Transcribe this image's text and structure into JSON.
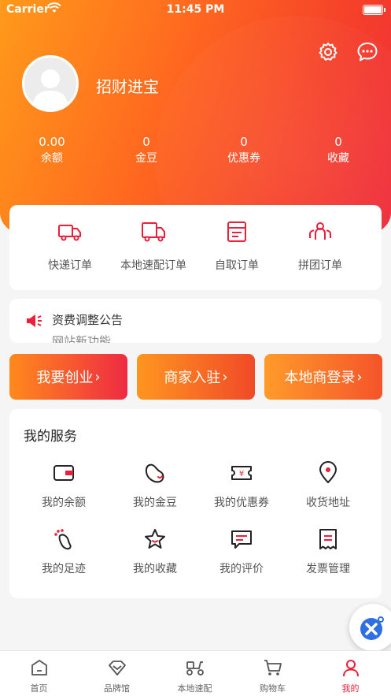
{
  "status_bar": {
    "carrier": "Carrier",
    "time": "11:45 PM"
  },
  "profile": {
    "name": "招财进宝"
  },
  "stats": [
    {
      "value": "0.00",
      "label": "余额"
    },
    {
      "value": "0",
      "label": "金豆"
    },
    {
      "value": "0",
      "label": "优惠券"
    },
    {
      "value": "0",
      "label": "收藏"
    }
  ],
  "orders": [
    {
      "label": "快递订单",
      "icon": "truck-icon"
    },
    {
      "label": "本地速配订单",
      "icon": "delivery-van-icon"
    },
    {
      "label": "自取订单",
      "icon": "receipt-icon"
    },
    {
      "label": "拼团订单",
      "icon": "group-icon"
    }
  ],
  "notice": {
    "text": "资费调整公告",
    "next_text": "网站新功能"
  },
  "actions": {
    "start_business": "我要创业",
    "merchant_join": "商家入驻",
    "local_login": "本地商登录"
  },
  "services": {
    "title": "我的服务",
    "items": [
      {
        "label": "我的余额",
        "icon": "wallet-icon"
      },
      {
        "label": "我的金豆",
        "icon": "bean-icon"
      },
      {
        "label": "我的优惠券",
        "icon": "coupon-icon"
      },
      {
        "label": "收货地址",
        "icon": "location-icon"
      },
      {
        "label": "我的足迹",
        "icon": "footprint-icon"
      },
      {
        "label": "我的收藏",
        "icon": "star-icon"
      },
      {
        "label": "我的评价",
        "icon": "comment-icon"
      },
      {
        "label": "发票管理",
        "icon": "invoice-icon"
      }
    ]
  },
  "tabs": [
    {
      "label": "首页",
      "icon": "home-icon"
    },
    {
      "label": "品牌馆",
      "icon": "diamond-icon"
    },
    {
      "label": "本地速配",
      "icon": "scooter-icon"
    },
    {
      "label": "购物车",
      "icon": "cart-icon"
    },
    {
      "label": "我的",
      "icon": "user-icon"
    }
  ],
  "colors": {
    "accent": "#e8203a",
    "gradient_start": "#ff9a1a",
    "gradient_end": "#ee2b3b"
  }
}
